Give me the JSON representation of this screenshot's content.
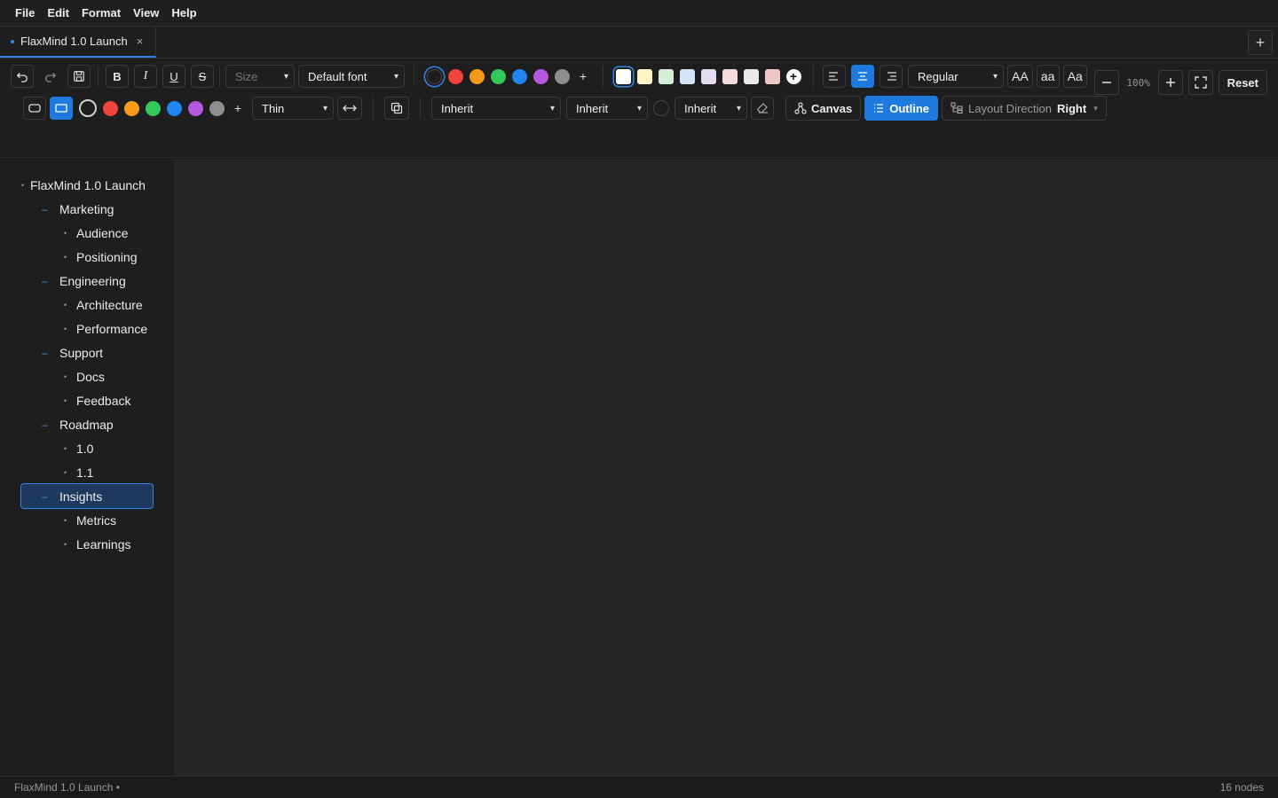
{
  "menubar": {
    "items": [
      "File",
      "Edit",
      "Format",
      "View",
      "Help"
    ]
  },
  "tabs": [
    {
      "label": "FlaxMind 1.0 Launch",
      "close": "×"
    }
  ],
  "new_tab": "+",
  "toolbar": {
    "bold": "B",
    "italic": "I",
    "underline": "U",
    "strike": "S",
    "size_placeholder": "Size",
    "font": "Default font",
    "text_colors": [
      "#1e1e1e",
      "#f0443a",
      "#f79a1b",
      "#34c759",
      "#1f86ef",
      "#b558e0",
      "#8e8e8e"
    ],
    "fill_colors": [
      "#ffffff",
      "#fdf3c6",
      "#d8ecd7",
      "#d3e5f8",
      "#e3dcf3",
      "#f6dbde",
      "#e9e9e9",
      "#f0c6c9"
    ],
    "weight": "Regular",
    "case_upper": "AA",
    "case_lower": "aa",
    "case_title": "Aa",
    "border_colors": [
      "#1e1e1e",
      "#f0443a",
      "#f79a1b",
      "#34c759",
      "#1f86ef",
      "#b558e0",
      "#8e8e8e"
    ],
    "line_weight": "Thin",
    "line_style_1": "Inherit",
    "line_style_2": "Inherit",
    "line_style_3": "Inherit",
    "view_canvas": "Canvas",
    "view_outline": "Outline",
    "layout_label": "Layout Direction",
    "layout_value": "Right"
  },
  "zoom": {
    "value": "100%",
    "reset": "Reset"
  },
  "outline": {
    "root": "FlaxMind 1.0 Launch",
    "groups": [
      {
        "label": "Marketing",
        "children": [
          "Audience",
          "Positioning"
        ]
      },
      {
        "label": "Engineering",
        "children": [
          "Architecture",
          "Performance"
        ]
      },
      {
        "label": "Support",
        "children": [
          "Docs",
          "Feedback"
        ]
      },
      {
        "label": "Roadmap",
        "children": [
          "1.0",
          "1.1"
        ]
      },
      {
        "label": "Insights",
        "children": [
          "Metrics",
          "Learnings"
        ]
      }
    ],
    "selected": "Insights"
  },
  "status": {
    "left": "FlaxMind 1.0 Launch •",
    "right": "16 nodes"
  }
}
